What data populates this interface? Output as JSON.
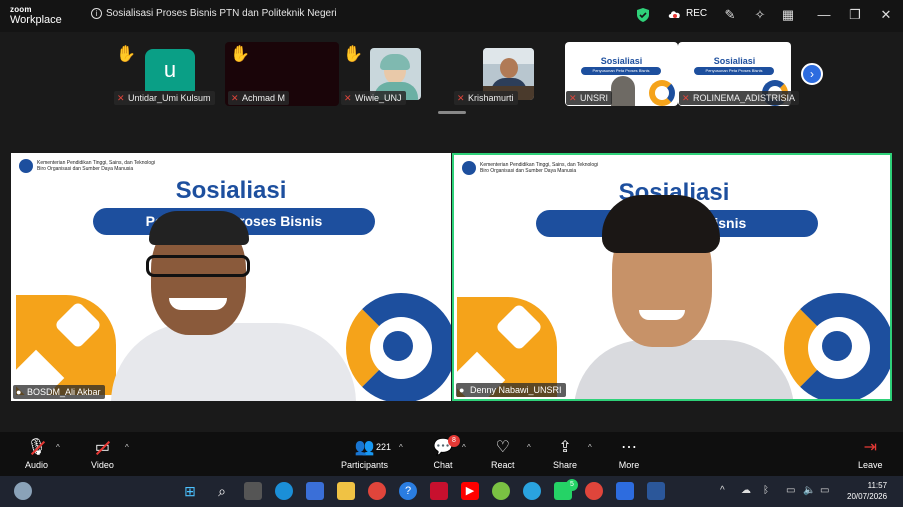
{
  "brand": {
    "line1": "zoom",
    "line2": "Workplace"
  },
  "meeting": {
    "title": "Sosialisasi Proses Bisnis PTN dan Politeknik Negeri"
  },
  "rec_label": "REC",
  "colors": {
    "accent": "#2d6cdf",
    "active_border": "#2fd179",
    "slide_blue": "#1d4f9e",
    "slide_orange": "#f5a31a",
    "mute_red": "#e53935"
  },
  "thumbnails": [
    {
      "name": "Untidar_Umi Kulsum",
      "avatar_letter": "u"
    },
    {
      "name": "Achmad M"
    },
    {
      "name": "Wiwie_UNJ"
    },
    {
      "name": "Krishamurti"
    },
    {
      "name": "UNSRI",
      "slide_title": "Sosialiasi",
      "slide_sub": "Penyusunan Peta Proses Bisnis"
    },
    {
      "name": "ROLINEMA_ADISTRISIA",
      "slide_title": "Sosialiasi",
      "slide_sub": "Penyusunan Peta Proses Bisnis"
    }
  ],
  "tiles": [
    {
      "name": "BOSDM_Ali Akbar",
      "ministry": "Kementerian Pendidikan Tinggi, Sains, dan Teknologi",
      "bureau": "Biro Organisasi dan Sumber Daya Manusia",
      "slide_title": "Sosialiasi",
      "slide_pill": "Peny          a Proses Bisnis"
    },
    {
      "name": "Denny Nabawi_UNSRI",
      "ministry": "Kementerian Pendidikan Tinggi, Sains, dan Teknologi",
      "bureau": "Biro Organisasi dan Sumber Daya Manusia",
      "slide_title": "Sosialiasi",
      "slide_pill": "Penyu           s Bisnis"
    }
  ],
  "toolbar": {
    "audio": "Audio",
    "video": "Video",
    "participants": "Participants",
    "participants_count": "221",
    "chat": "Chat",
    "chat_badge": "8",
    "react": "React",
    "share": "Share",
    "more": "More",
    "leave": "Leave"
  },
  "taskbar": {
    "whatsapp_badge": "5",
    "time": "11:57",
    "date": "20/07/2026"
  }
}
